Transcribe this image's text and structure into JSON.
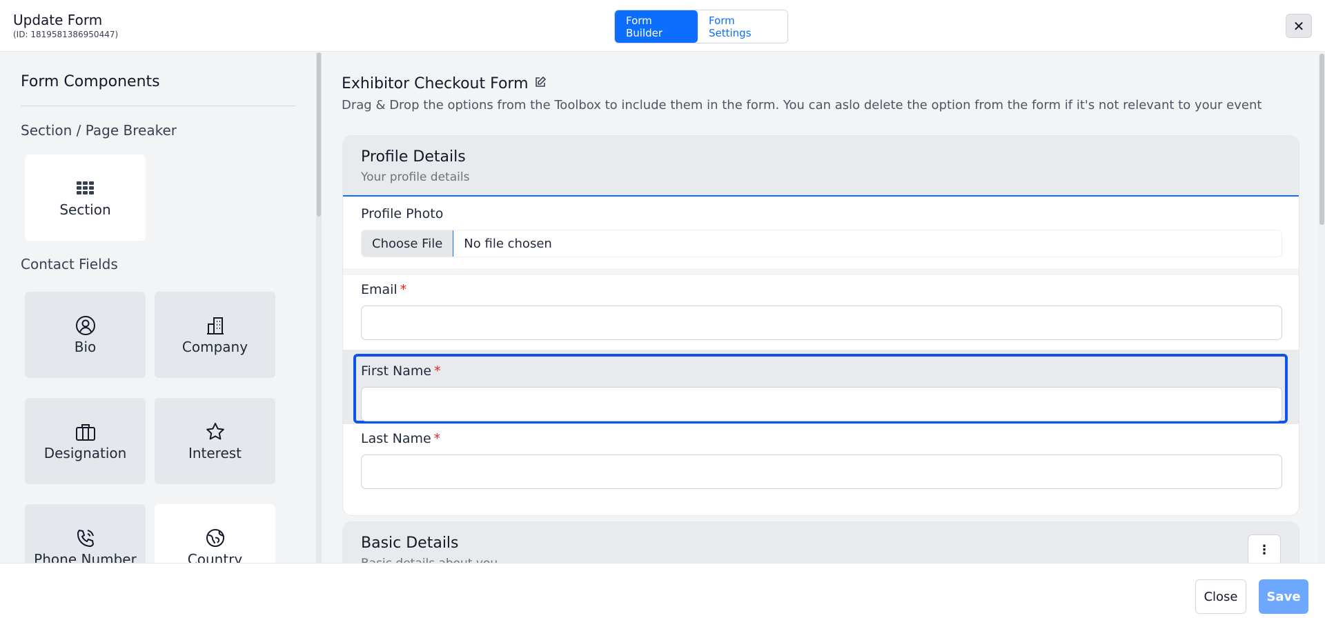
{
  "header": {
    "title": "Update Form",
    "id_text": "(ID: 1819581386950447)",
    "tabs": [
      {
        "label": "Form Builder",
        "active": true
      },
      {
        "label": "Form Settings",
        "active": false
      }
    ],
    "close_glyph": "✕"
  },
  "sidebar": {
    "title": "Form Components",
    "groups": [
      {
        "label": "Section / Page Breaker",
        "items": [
          {
            "label": "Section",
            "icon": "grid-icon"
          }
        ]
      },
      {
        "label": "Contact Fields",
        "items": [
          {
            "label": "Bio",
            "icon": "user-circle-icon"
          },
          {
            "label": "Company",
            "icon": "building-icon"
          },
          {
            "label": "Designation",
            "icon": "briefcase-icon"
          },
          {
            "label": "Interest",
            "icon": "star-icon"
          },
          {
            "label": "Phone Number",
            "icon": "phone-icon"
          },
          {
            "label": "Country",
            "icon": "globe-icon"
          }
        ]
      }
    ]
  },
  "main": {
    "form_title": "Exhibitor Checkout Form",
    "form_description": "Drag & Drop the options from the Toolbox to include them in the form. You can aslo delete the option from the form if it's not relevant to your event",
    "sections": [
      {
        "title": "Profile Details",
        "subtitle": "Your profile details",
        "fields": [
          {
            "label": "Profile Photo",
            "type": "file",
            "button": "Choose File",
            "status": "No file chosen",
            "required": false
          },
          {
            "label": "Email",
            "type": "text",
            "required": true,
            "value": ""
          },
          {
            "label": "First Name",
            "type": "text",
            "required": true,
            "value": "",
            "selected": true
          },
          {
            "label": "Last Name",
            "type": "text",
            "required": true,
            "value": ""
          }
        ]
      },
      {
        "title": "Basic Details",
        "subtitle": "Basic details about you",
        "menu_glyph": "⋮"
      }
    ],
    "required_marker": "*"
  },
  "footer": {
    "close_label": "Close",
    "save_label": "Save"
  },
  "colors": {
    "primary": "#0d6efd",
    "save_disabled": "#6ea8fe",
    "required": "#dc2626",
    "selection_border": "#0d55e8"
  }
}
